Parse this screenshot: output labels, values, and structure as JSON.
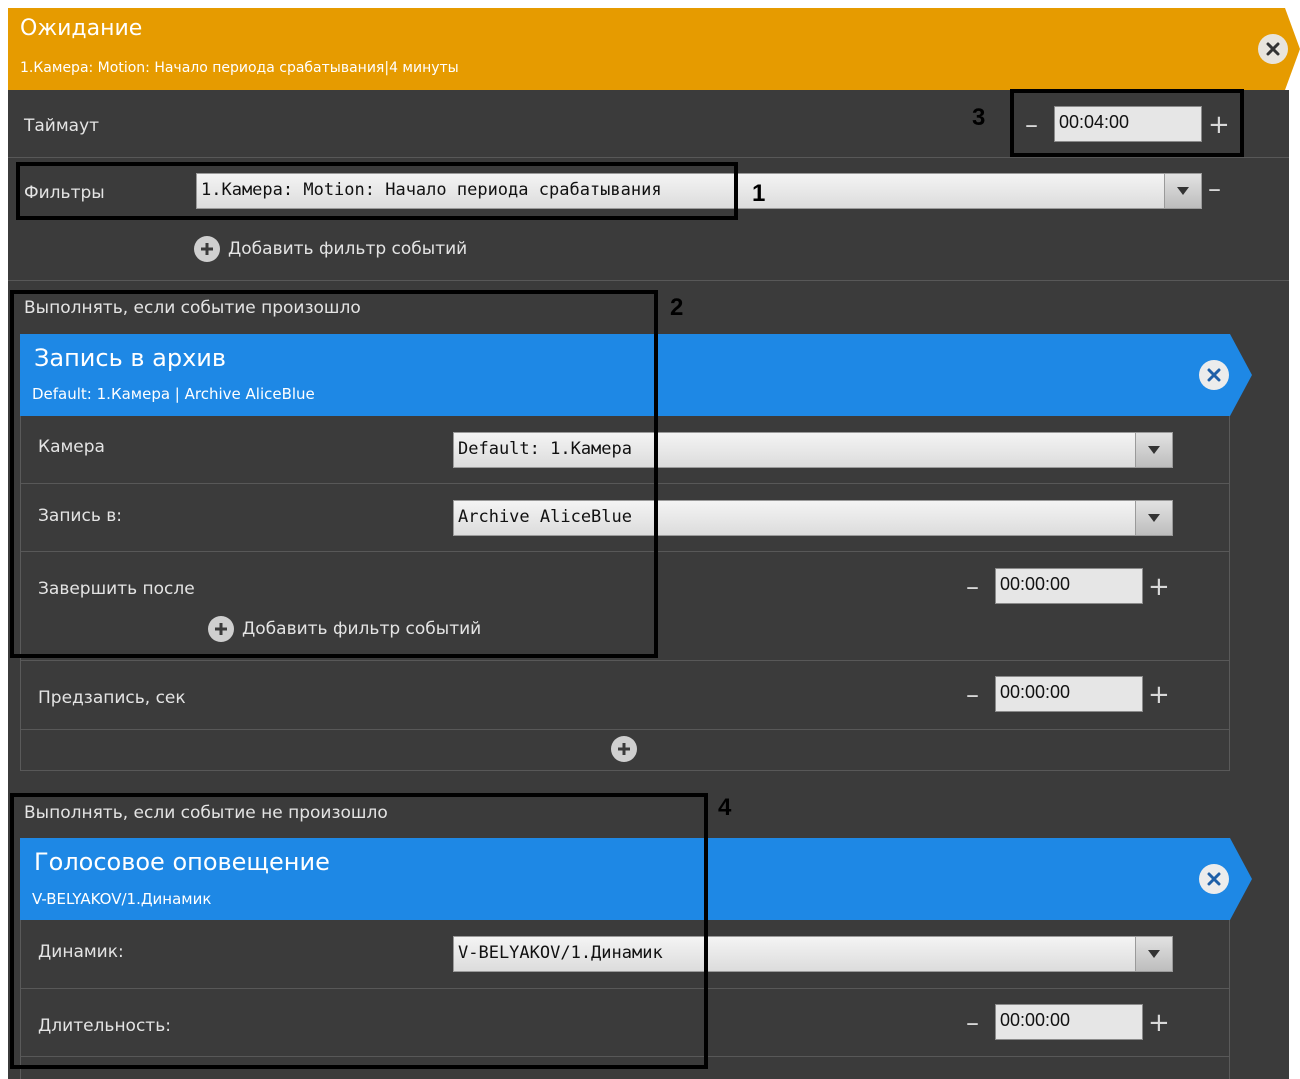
{
  "header": {
    "title": "Ожидание",
    "subtitle": "1.Камера: Motion: Начало периода срабатывания|4 минуты"
  },
  "timeout": {
    "label": "Таймаут",
    "value": "00:04:00"
  },
  "filters": {
    "label": "Фильтры",
    "selected": "1.Камера: Motion: Начало периода срабатывания",
    "add_label": "Добавить фильтр событий"
  },
  "if_happened": {
    "section_label": "Выполнять, если событие произошло",
    "action": {
      "title": "Запись в архив",
      "subtitle": "Default: 1.Камера | Archive AliceBlue",
      "camera_label": "Камера",
      "camera_value": "Default: 1.Камера",
      "record_to_label": "Запись в:",
      "record_to_value": "Archive AliceBlue",
      "finish_after_label": "Завершить после",
      "finish_after_value": "00:00:00",
      "add_filter_label": "Добавить фильтр событий",
      "prerecord_label": "Предзапись, сек",
      "prerecord_value": "00:00:00"
    }
  },
  "if_not_happened": {
    "section_label": "Выполнять, если событие не произошло",
    "action": {
      "title": "Голосовое оповещение",
      "subtitle": "V-BELYAKOV/1.Динамик",
      "speaker_label": "Динамик:",
      "speaker_value": "V-BELYAKOV/1.Динамик",
      "duration_label": "Длительность:",
      "duration_value": "00:00:00"
    }
  },
  "annotations": [
    "1",
    "2",
    "3",
    "4"
  ],
  "symbols": {
    "minus": "–",
    "plus": "+"
  },
  "colors": {
    "header_orange": "#e69b00",
    "action_blue": "#1e88e5",
    "panel_dark": "#3b3b3b"
  }
}
